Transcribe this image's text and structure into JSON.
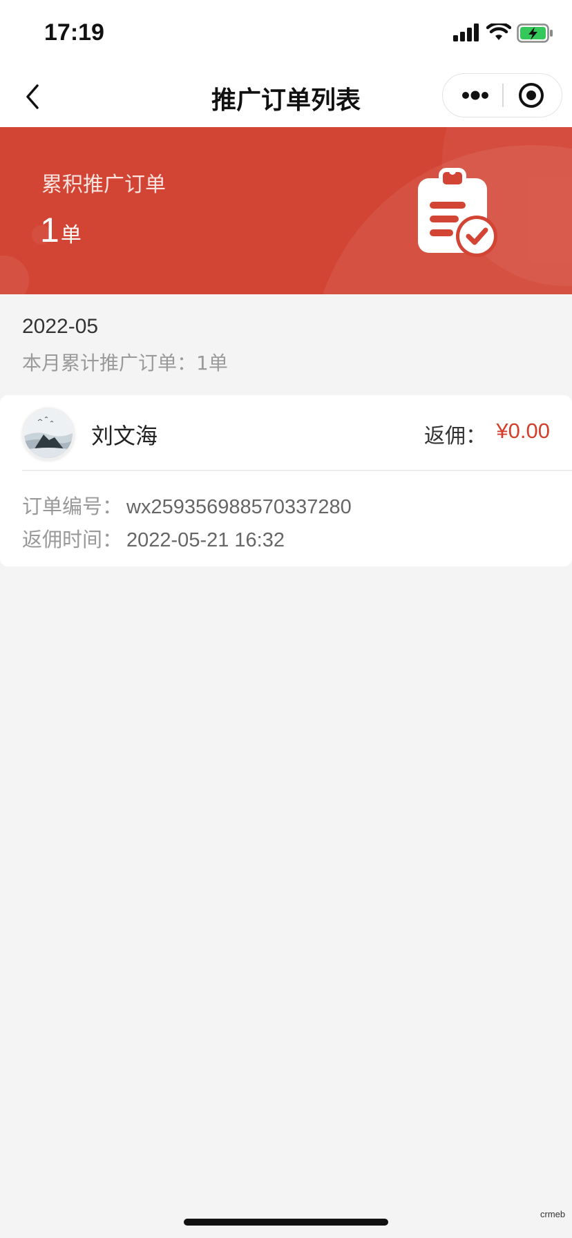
{
  "status_bar": {
    "time": "17:19"
  },
  "nav": {
    "title": "推广订单列表"
  },
  "banner": {
    "label": "累积推广订单",
    "count": "1",
    "unit": "单"
  },
  "month": {
    "label": "2022-05",
    "summary": "本月累计推广订单：1单"
  },
  "order": {
    "user_name": "刘文海",
    "rebate_label": "返佣：",
    "rebate_amount": "¥0.00",
    "order_no_label": "订单编号：",
    "order_no": "wx259356988570337280",
    "rebate_time_label": "返佣时间：",
    "rebate_time": "2022-05-21 16:32"
  },
  "watermark": "crmeb",
  "icons": {
    "back": "back-chevron-icon",
    "more": "more-dots-icon",
    "target": "target-icon",
    "clipboard": "clipboard-check-icon"
  },
  "colors": {
    "banner": "#d24434",
    "accent_price": "#d2402c",
    "background": "#f4f4f4"
  }
}
